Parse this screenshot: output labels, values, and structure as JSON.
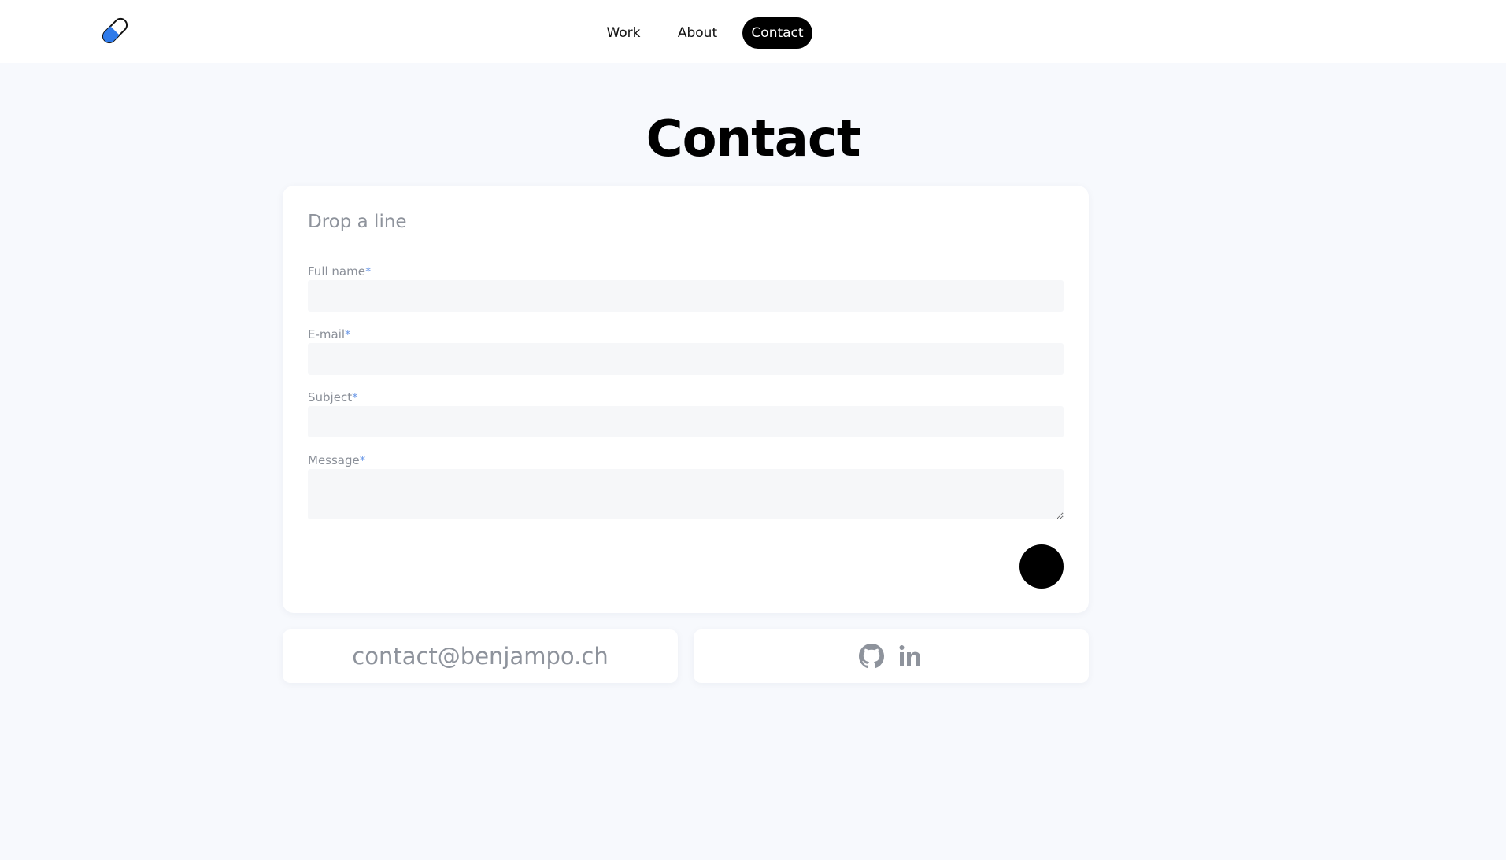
{
  "header": {
    "logo_icon": "diamond-pill-logo-icon",
    "nav": {
      "work_label": "Work",
      "about_label": "About",
      "contact_label": "Contact"
    }
  },
  "main": {
    "title": "Contact",
    "form": {
      "heading": "Drop a line",
      "fields": [
        {
          "label": "Full name",
          "required_mark": "*",
          "value": ""
        },
        {
          "label": "E-mail",
          "required_mark": "*",
          "value": ""
        },
        {
          "label": "Subject",
          "required_mark": "*",
          "value": ""
        },
        {
          "label": "Message",
          "required_mark": "*",
          "value": ""
        }
      ],
      "submit_icon": "submit-circle-icon"
    },
    "email": "contact@benjampo.ch",
    "social": {
      "github_icon": "github-icon",
      "linkedin_icon": "linkedin-icon"
    }
  },
  "colors": {
    "page_background": "#f7f9fd",
    "accent": "#2f7bea",
    "required": "#6f9be8",
    "muted_text": "#8e939c",
    "input_background": "#f6f7f9"
  }
}
